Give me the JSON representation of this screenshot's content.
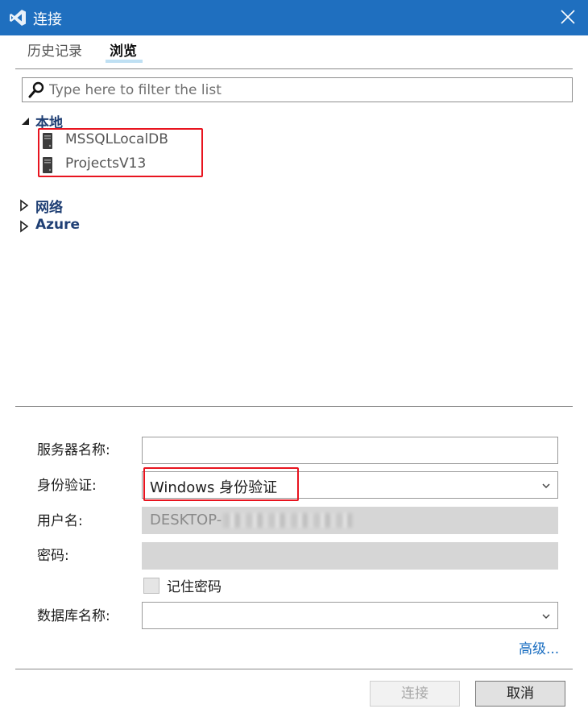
{
  "window": {
    "title": "连接",
    "logo_icon": "visual-studio-icon",
    "close_icon": "close-icon"
  },
  "tabs": {
    "history": "历史记录",
    "browse": "浏览",
    "active": "浏览"
  },
  "filter": {
    "placeholder": "Type here to filter the list",
    "value": ""
  },
  "tree": {
    "local": {
      "label": "本地",
      "expanded": true,
      "servers": [
        {
          "name": "MSSQLLocalDB"
        },
        {
          "name": "ProjectsV13"
        }
      ]
    },
    "network": {
      "label": "网络",
      "expanded": false
    },
    "azure": {
      "label": "Azure",
      "expanded": false
    }
  },
  "form": {
    "server_name": {
      "label": "服务器名称:",
      "value": ""
    },
    "auth": {
      "label": "身份验证:",
      "value": "Windows 身份验证"
    },
    "username": {
      "label": "用户名:",
      "value": "DESKTOP-"
    },
    "password": {
      "label": "密码:",
      "value": ""
    },
    "remember": {
      "label": "记住密码",
      "checked": false
    },
    "database": {
      "label": "数据库名称:",
      "value": ""
    },
    "advanced": "高级..."
  },
  "buttons": {
    "connect": "连接",
    "cancel": "取消"
  },
  "colors": {
    "titlebar": "#1f6fbf",
    "highlight_box": "#e8141f",
    "tree_label": "#1f3f74",
    "link": "#1a6ec1"
  }
}
